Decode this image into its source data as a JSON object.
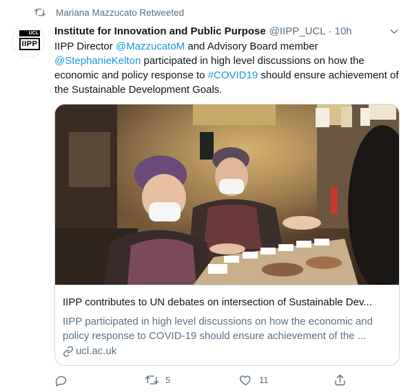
{
  "retweet": {
    "icon": "retweet-icon",
    "text": "Mariana Mazzucato Retweeted"
  },
  "author": {
    "avatar_top": "UCL",
    "avatar_main": "IIPP",
    "name": "Institute for Innovation and Public Purpose",
    "handle": "@IIPP_UCL",
    "separator": "·",
    "time": "10h"
  },
  "tweet": {
    "t1": "IIPP Director ",
    "m1": "@MazzucatoM",
    "t2": " and Advisory Board member ",
    "m2": "@StephanieKelton",
    "t3": " participated in high level discussions on how the economic and policy response to ",
    "h1": "#COVID19",
    "t4": " should ensure achievement of the Sustainable Development Goals."
  },
  "card": {
    "title": "IIPP contributes to UN debates on intersection of Sustainable Dev...",
    "description": "IIPP participated in high level discussions on how the economic and policy response to COVID-19 should ensure achievement of the ...",
    "domain": "ucl.ac.uk",
    "image_alt": "Two women in face masks at a market stall"
  },
  "actions": {
    "reply": {
      "icon": "reply-icon",
      "count": ""
    },
    "retweet": {
      "icon": "retweet-icon",
      "count": "5"
    },
    "like": {
      "icon": "heart-icon",
      "count": "11"
    },
    "share": {
      "icon": "share-icon",
      "count": ""
    }
  },
  "colors": {
    "link": "#1b95e0",
    "muted": "#5b7083",
    "text": "#0f1419",
    "border": "#cfd9de"
  }
}
